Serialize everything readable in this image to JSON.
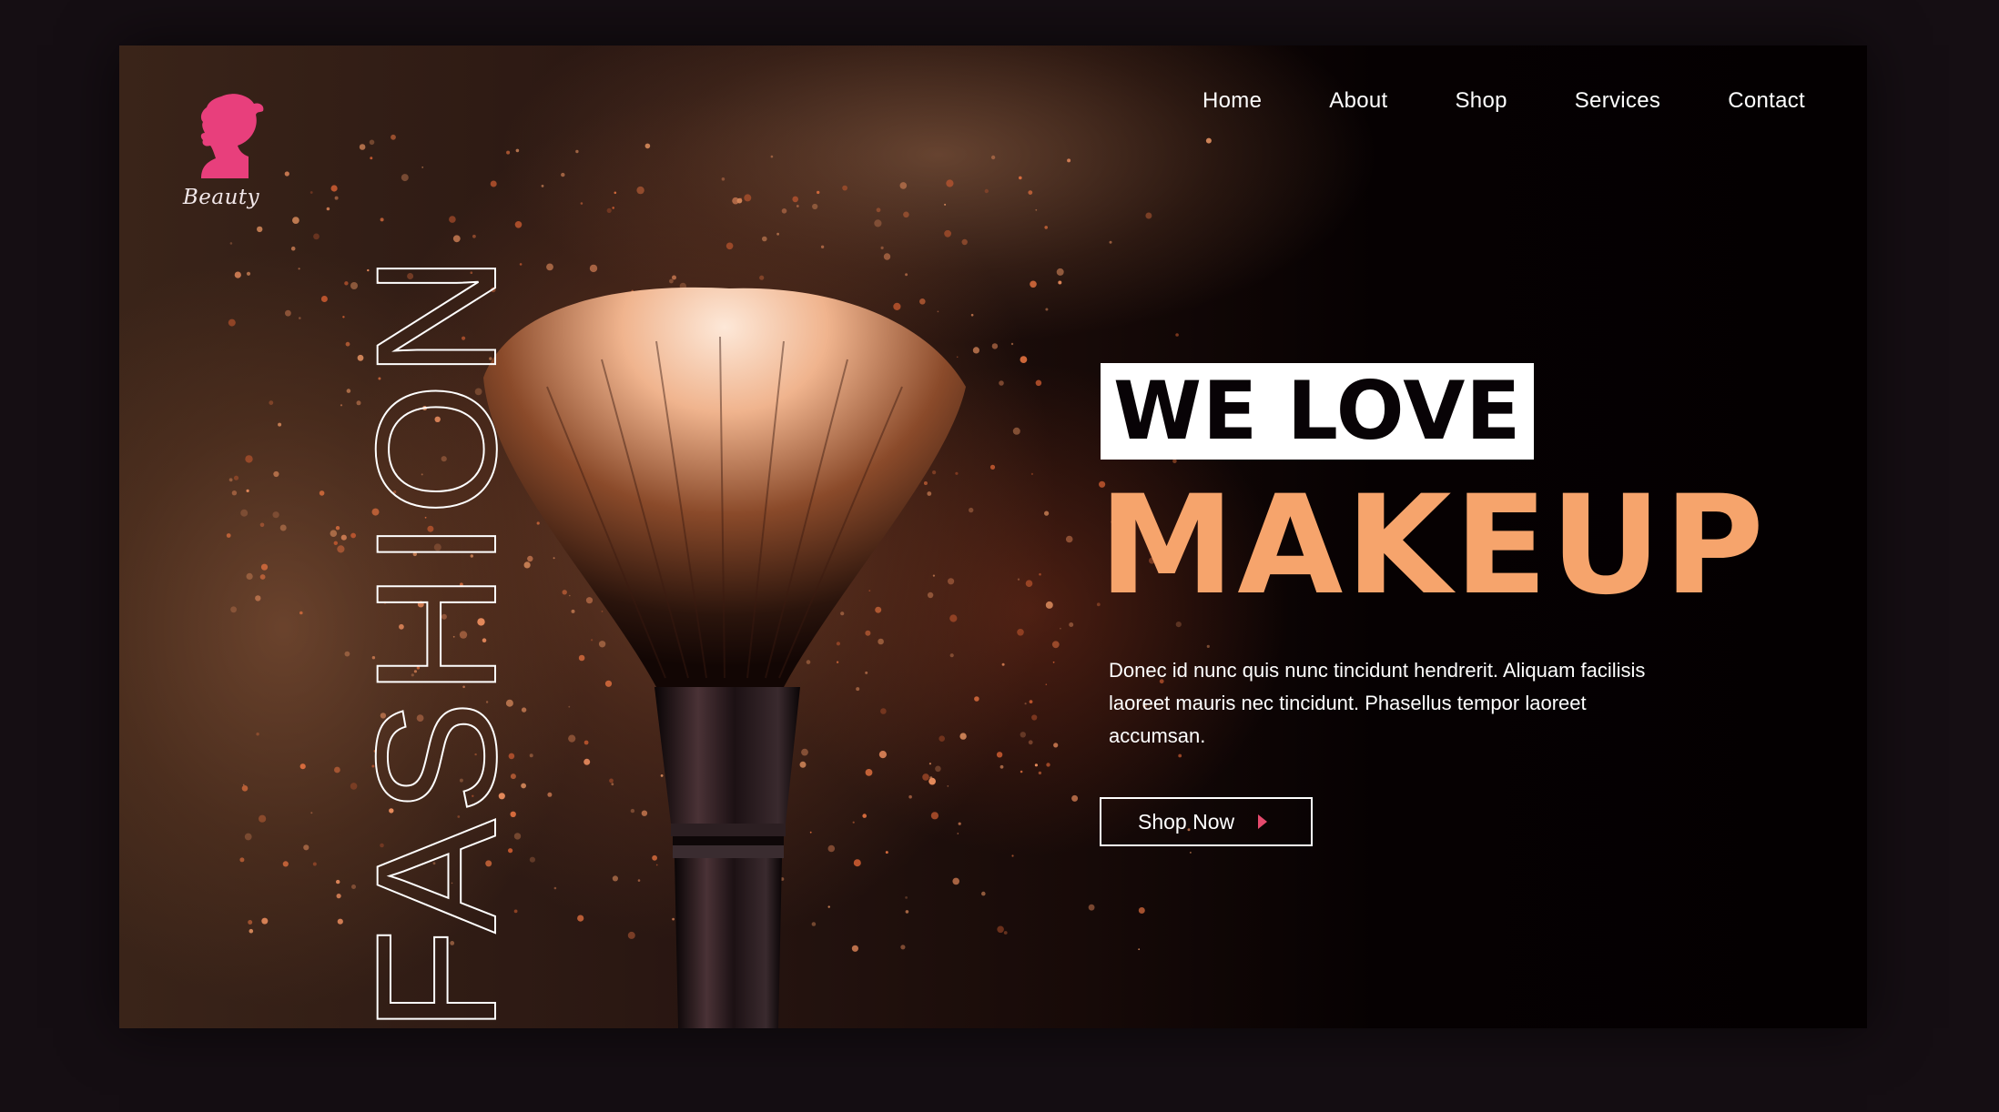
{
  "logo": {
    "text": "Beauty",
    "icon": "woman-silhouette-icon",
    "color": "#e83f7c"
  },
  "nav": {
    "items": [
      "Home",
      "About",
      "Shop",
      "Services",
      "Contact"
    ]
  },
  "hero": {
    "vertical_word": "FASHION",
    "tag": "WE LOVE",
    "title": "MAKEUP",
    "body": "Donec id nunc quis nunc tincidunt hendrerit. Aliquam facilisis laoreet mauris nec tincidunt. Phasellus tempor laoreet accumsan.",
    "button_label": "Shop Now",
    "button_icon": "play-triangle-icon"
  },
  "colors": {
    "accent": "#f6a46c",
    "logo": "#e83f7c",
    "button_arrow": "#e54a6d",
    "background": "#040001"
  }
}
